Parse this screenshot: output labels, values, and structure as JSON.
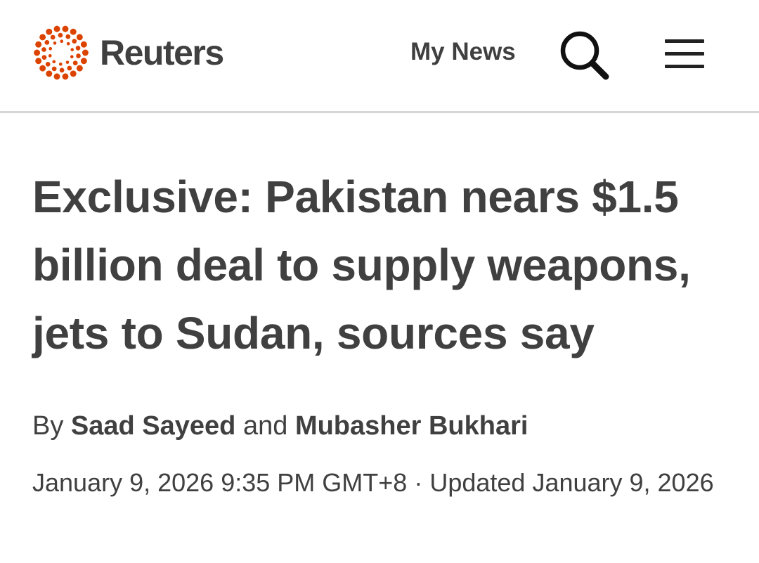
{
  "header": {
    "brand_name": "Reuters",
    "brand_logo_icon": "reuters-dotted-circle-logo-icon",
    "my_news_label": "My News",
    "search_icon": "search-icon",
    "menu_icon": "hamburger-menu-icon",
    "brand_color": "#DC4300",
    "text_color": "#404040",
    "divider_color": "#D6D6D6"
  },
  "article": {
    "headline": "Exclusive: Pakistan nears $1.5 billion deal to supply weapons, jets to Sudan, sources say",
    "byline": {
      "prefix": "By",
      "author_1": "Saad Sayeed",
      "conjunction": "and",
      "author_2": "Mubasher Bukhari"
    },
    "published": "January 9, 2026 9:35 PM GMT+8",
    "separator": "·",
    "updated": "Updated January 9, 2026"
  }
}
